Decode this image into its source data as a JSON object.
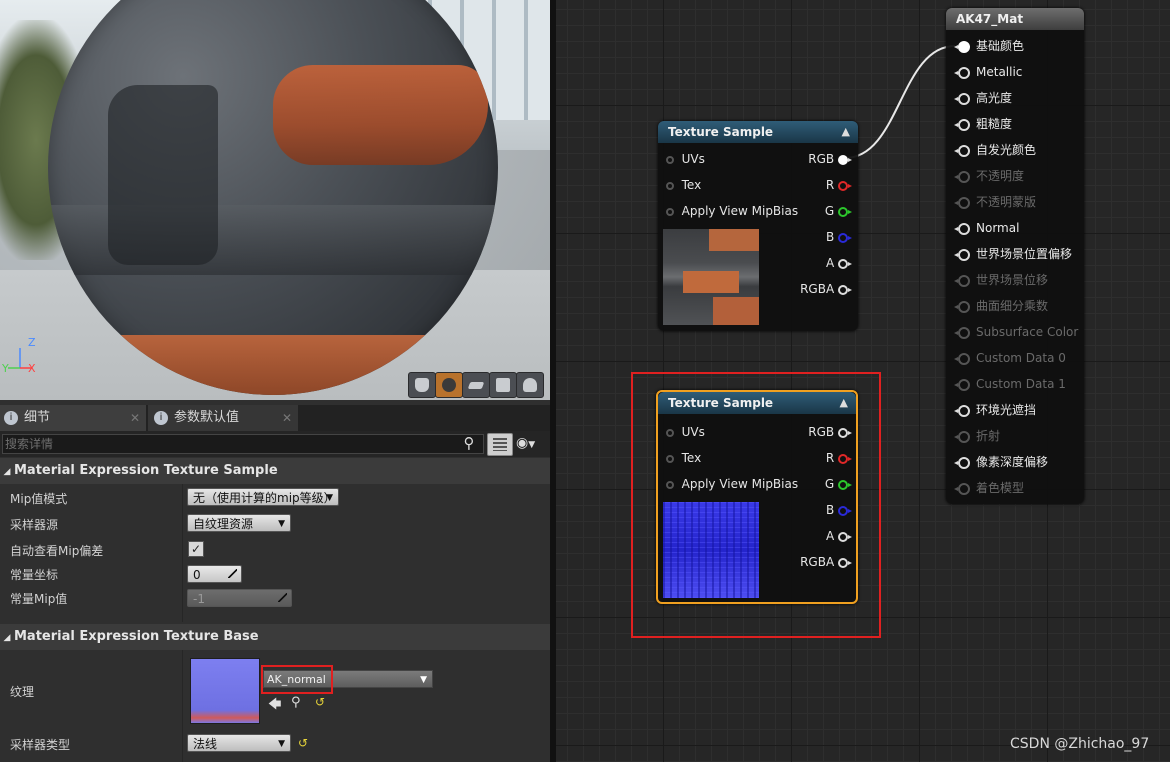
{
  "viewport": {
    "axis_labels": {
      "z": "Z",
      "y": "Y",
      "x": "X"
    },
    "buttons": [
      "cylinder-preview",
      "sphere-preview",
      "plane-preview",
      "cube-preview",
      "custom-mesh-preview"
    ]
  },
  "tabs": [
    {
      "label": "细节"
    },
    {
      "label": "参数默认值"
    }
  ],
  "search": {
    "placeholder": "搜索详情"
  },
  "sections": {
    "texture_sample": "Material Expression Texture Sample",
    "texture_base": "Material Expression Texture Base"
  },
  "properties": {
    "mip_mode": {
      "label": "Mip值模式",
      "value": "无（使用计算的mip等级）"
    },
    "sampler_source": {
      "label": "采样器源",
      "value": "自纹理资源"
    },
    "auto_view_mip_bias": {
      "label": "自动查看Mip偏差",
      "checked": true,
      "mark": "✓"
    },
    "const_coordinate": {
      "label": "常量坐标",
      "value": "0"
    },
    "const_mip": {
      "label": "常量Mip值",
      "value": "-1"
    },
    "texture": {
      "label": "纹理",
      "value": "AK_normal"
    },
    "sampler_type": {
      "label": "采样器类型",
      "value": "法线"
    }
  },
  "nodes": {
    "texture_sample_1": {
      "title": "Texture Sample",
      "inputs": [
        "UVs",
        "Tex",
        "Apply View MipBias"
      ],
      "outputs": [
        "RGB",
        "R",
        "G",
        "B",
        "A",
        "RGBA"
      ]
    },
    "texture_sample_2": {
      "title": "Texture Sample",
      "inputs": [
        "UVs",
        "Tex",
        "Apply View MipBias"
      ],
      "outputs": [
        "RGB",
        "R",
        "G",
        "B",
        "A",
        "RGBA"
      ]
    },
    "material": {
      "title": "AK47_Mat",
      "inputs": [
        {
          "label": "基础颜色",
          "state": "connected"
        },
        {
          "label": "Metallic",
          "state": "active"
        },
        {
          "label": "高光度",
          "state": "active"
        },
        {
          "label": "粗糙度",
          "state": "active"
        },
        {
          "label": "自发光颜色",
          "state": "active"
        },
        {
          "label": "不透明度",
          "state": "disabled"
        },
        {
          "label": "不透明蒙版",
          "state": "disabled"
        },
        {
          "label": "Normal",
          "state": "active"
        },
        {
          "label": "世界场景位置偏移",
          "state": "active"
        },
        {
          "label": "世界场景位移",
          "state": "disabled"
        },
        {
          "label": "曲面细分乘数",
          "state": "disabled"
        },
        {
          "label": "Subsurface Color",
          "state": "disabled"
        },
        {
          "label": "Custom Data 0",
          "state": "disabled"
        },
        {
          "label": "Custom Data 1",
          "state": "disabled"
        },
        {
          "label": "环境光遮挡",
          "state": "active"
        },
        {
          "label": "折射",
          "state": "disabled"
        },
        {
          "label": "像素深度偏移",
          "state": "active"
        },
        {
          "label": "着色模型",
          "state": "disabled"
        }
      ]
    }
  },
  "colors": {
    "highlight": "#e02020",
    "selected_node_outline": "#f0a020",
    "node_header": "#2f5d78",
    "pin_r": "#e02828",
    "pin_g": "#2cc72c",
    "pin_b": "#2a2ad8"
  },
  "watermark": "CSDN @Zhichao_97"
}
